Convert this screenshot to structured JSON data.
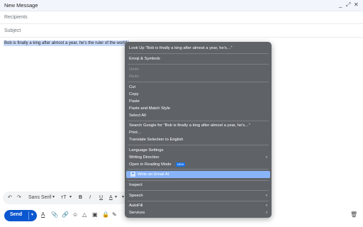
{
  "window": {
    "title": "New Message",
    "minimize": "_",
    "expand": "⤢",
    "close": "✕"
  },
  "compose": {
    "recipients_placeholder": "Recipients",
    "subject_placeholder": "Subject",
    "body_text": "Bob is finally a king after almost a year, he's the ruler of the world."
  },
  "formatting": {
    "undo": "↶",
    "redo": "↷",
    "font": "Sans Serif",
    "font_caret": "▾",
    "size": "тT",
    "size_caret": "▾",
    "bold": "B",
    "italic": "I",
    "underline": "U",
    "color": "A",
    "color_caret": "▾",
    "more": "▾"
  },
  "bottom": {
    "send_label": "Send",
    "send_options": "▾",
    "tools": [
      "A",
      "📎",
      "🔗",
      "☺",
      "△",
      "▣",
      "🔒",
      "✎"
    ],
    "delete": "🗑"
  },
  "context_menu": {
    "look_up": "Look Up “Bob is finally a king after almost a year, he's…”",
    "emoji": "Emoji & Symbols",
    "undo": "Undo",
    "redo": "Redo",
    "cut": "Cut",
    "copy": "Copy",
    "paste": "Paste",
    "paste_match": "Paste and Match Style",
    "select_all": "Select All",
    "search_google": "Search Google for “Bob is finally a king after almost a year, he's…”",
    "print": "Print…",
    "translate": "Translate Selection to English",
    "language": "Language Settings",
    "writing_direction": "Writing Direction",
    "reading_mode": "Open in Reading Mode",
    "reading_badge": "NEW",
    "write_ai": "Write an Email AI",
    "inspect": "Inspect",
    "speech": "Speech",
    "autofill": "AutoFill",
    "services": "Services",
    "submenu_arrow": "›"
  }
}
